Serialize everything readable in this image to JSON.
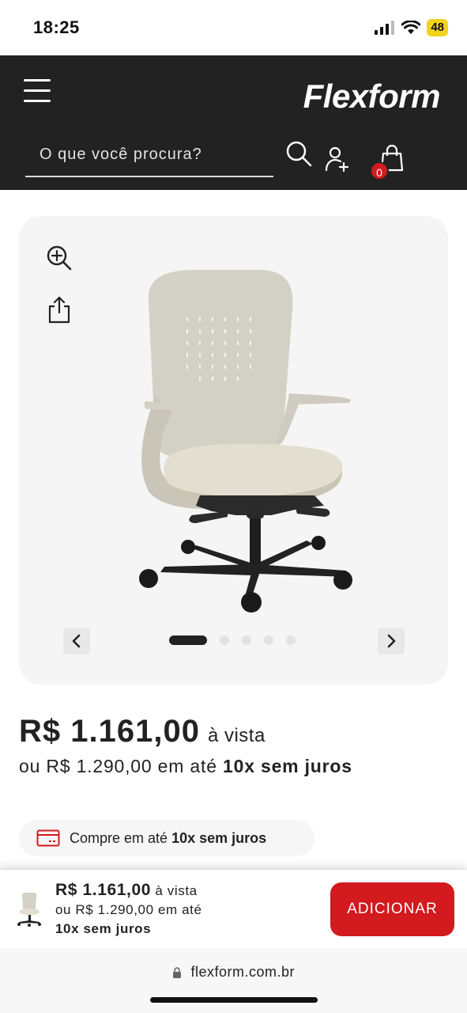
{
  "status_bar": {
    "time": "18:25",
    "battery": "48"
  },
  "header": {
    "logo": "Flexform",
    "search_placeholder": "O que você procura?",
    "cart_count": "0"
  },
  "gallery": {
    "dots_total": 5,
    "dots_active": 1
  },
  "price": {
    "value": "R$ 1.161,00",
    "cash_label": "à vista",
    "installment_prefix": "ou R$ 1.290,00 em até",
    "installment_bold": "10x sem juros"
  },
  "promo_pill": {
    "prefix": "Compre em até",
    "bold": "10x sem juros"
  },
  "sticky_bar": {
    "price": "R$ 1.161,00",
    "cash_label": "à vista",
    "installment_prefix": "ou R$ 1.290,00 em até",
    "installment_bold": "10x sem juros",
    "button_label": "ADICIONAR",
    "button_color": "#d21a1f"
  },
  "browser": {
    "url": "flexform.com.br"
  },
  "colors": {
    "header_bg": "#222222",
    "accent": "#d21a1f",
    "gallery_bg": "#f5f5f5"
  }
}
